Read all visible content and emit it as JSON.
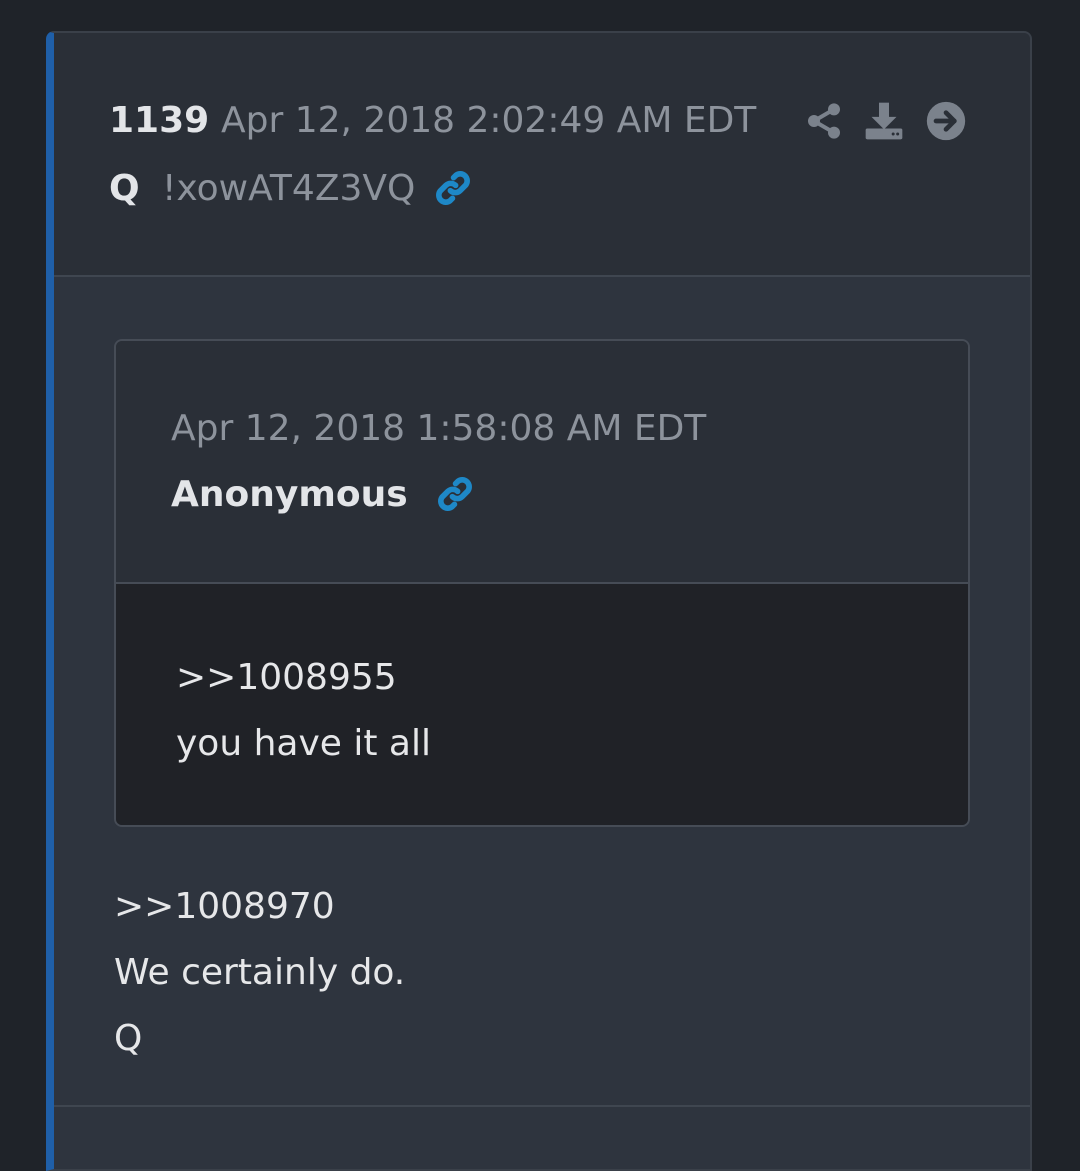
{
  "post": {
    "number": "1139",
    "date": "Apr 12, 2018 2:02:49 AM EDT",
    "author": "Q",
    "tripcode": "!xowAT4Z3VQ",
    "actions": [
      {
        "icon": "share-icon"
      },
      {
        "icon": "download-icon"
      },
      {
        "icon": "arrow-right-circle-icon"
      }
    ],
    "body_lines": [
      ">>1008970",
      "We certainly do.",
      "Q"
    ]
  },
  "quoted_post": {
    "date": "Apr 12, 2018 1:58:08 AM EDT",
    "author": "Anonymous",
    "body_lines": [
      ">>1008955",
      "you have it all"
    ]
  },
  "colors": {
    "page_bg": "#1f2329",
    "card_bg": "#2e343e",
    "header_bg": "#2a2f37",
    "accent_bar": "#1f5fa8",
    "link_icon": "#1e88c7",
    "muted_text": "#8d939c",
    "text": "#e3e5e8"
  }
}
